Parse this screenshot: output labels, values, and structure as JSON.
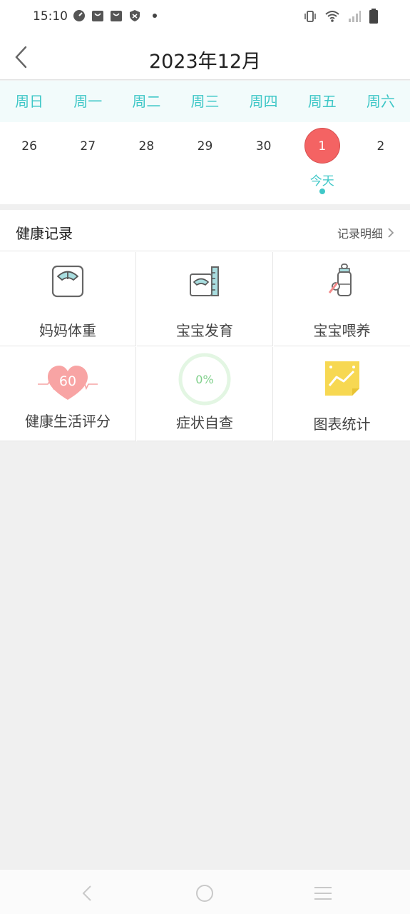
{
  "status_bar": {
    "time": "15:10",
    "left_icons": [
      "speedometer-icon",
      "shopping-bag-icon",
      "shopping-bag-icon",
      "shield-icon",
      "dot-icon"
    ],
    "right_icons": [
      "vibrate-icon",
      "wifi-icon",
      "signal-icon",
      "battery-icon"
    ]
  },
  "header": {
    "title": "2023年12月",
    "back_icon": "chevron-left-icon"
  },
  "calendar": {
    "weekdays": [
      "周日",
      "周一",
      "周二",
      "周三",
      "周四",
      "周五",
      "周六"
    ],
    "dates": [
      "26",
      "27",
      "28",
      "29",
      "30",
      "1",
      "2"
    ],
    "today_index": 5,
    "today_label": "今天",
    "colors": {
      "accent": "#3fc7c7",
      "today": "#f46363"
    }
  },
  "health": {
    "title": "健康记录",
    "detail_link": "记录明细",
    "items": [
      {
        "label": "妈妈体重",
        "icon": "scale-icon"
      },
      {
        "label": "宝宝发育",
        "icon": "baby-scale-icon"
      },
      {
        "label": "宝宝喂养",
        "icon": "baby-bottle-icon"
      },
      {
        "label": "健康生活评分",
        "icon": "heart-score-icon",
        "value": "60"
      },
      {
        "label": "症状自查",
        "icon": "progress-ring-icon",
        "value": "0%"
      },
      {
        "label": "图表统计",
        "icon": "chart-note-icon"
      }
    ]
  },
  "nav_bar": {
    "icons": [
      "back-icon",
      "home-icon",
      "menu-icon"
    ]
  }
}
